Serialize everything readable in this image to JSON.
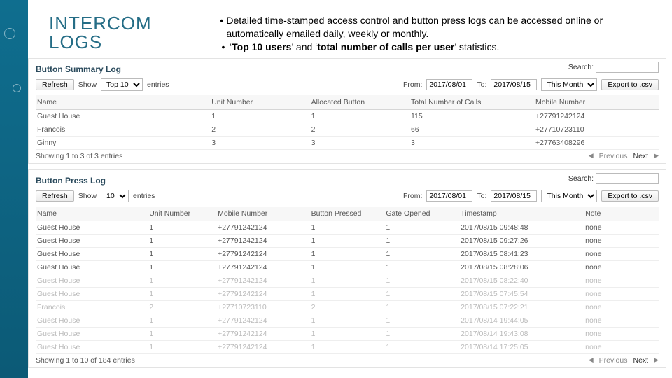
{
  "header": {
    "title_line1": "INTERCOM",
    "title_line2": "LOGS",
    "bullet1_a": "Detailed time-stamped access control and button press logs can be accessed online or automatically emailed daily, weekly or monthly.",
    "bullet2_pre": "‘",
    "bullet2_b1": "Top 10 users",
    "bullet2_mid": "’ and ‘",
    "bullet2_b2": "total number of calls per user",
    "bullet2_post": "’ statistics."
  },
  "common": {
    "refresh": "Refresh",
    "show": "Show",
    "entries": "entries",
    "from": "From:",
    "to": "To:",
    "export": "Export to .csv",
    "search": "Search:",
    "previous": "Previous",
    "next": "Next"
  },
  "summary": {
    "title": "Button Summary Log",
    "top_option": "Top 10",
    "from_val": "2017/08/01",
    "to_val": "2017/08/15",
    "range": "This Month",
    "cols": {
      "name": "Name",
      "unit": "Unit Number",
      "btn": "Allocated Button",
      "calls": "Total Number of Calls",
      "mobile": "Mobile Number"
    },
    "rows": [
      {
        "name": "Guest House",
        "unit": "1",
        "btn": "1",
        "calls": "115",
        "mobile": "+27791242124"
      },
      {
        "name": "Francois",
        "unit": "2",
        "btn": "2",
        "calls": "66",
        "mobile": "+27710723110"
      },
      {
        "name": "Ginny",
        "unit": "3",
        "btn": "3",
        "calls": "3",
        "mobile": "+27763408296"
      }
    ],
    "showing": "Showing 1 to 3 of 3 entries"
  },
  "press": {
    "title": "Button Press Log",
    "show_val": "10",
    "from_val": "2017/08/01",
    "to_val": "2017/08/15",
    "range": "This Month",
    "cols": {
      "name": "Name",
      "unit": "Unit Number",
      "mobile": "Mobile Number",
      "pressed": "Button Pressed",
      "gate": "Gate Opened",
      "ts": "Timestamp",
      "note": "Note"
    },
    "rows": [
      {
        "name": "Guest House",
        "unit": "1",
        "mobile": "+27791242124",
        "pressed": "1",
        "gate": "1",
        "ts": "2017/08/15 09:48:48",
        "note": "none",
        "dim": false
      },
      {
        "name": "Guest House",
        "unit": "1",
        "mobile": "+27791242124",
        "pressed": "1",
        "gate": "1",
        "ts": "2017/08/15 09:27:26",
        "note": "none",
        "dim": false
      },
      {
        "name": "Guest House",
        "unit": "1",
        "mobile": "+27791242124",
        "pressed": "1",
        "gate": "1",
        "ts": "2017/08/15 08:41:23",
        "note": "none",
        "dim": false
      },
      {
        "name": "Guest House",
        "unit": "1",
        "mobile": "+27791242124",
        "pressed": "1",
        "gate": "1",
        "ts": "2017/08/15 08:28:06",
        "note": "none",
        "dim": false
      },
      {
        "name": "Guest House",
        "unit": "1",
        "mobile": "+27791242124",
        "pressed": "1",
        "gate": "1",
        "ts": "2017/08/15 08:22:40",
        "note": "none",
        "dim": true
      },
      {
        "name": "Guest House",
        "unit": "1",
        "mobile": "+27791242124",
        "pressed": "1",
        "gate": "1",
        "ts": "2017/08/15 07:45:54",
        "note": "none",
        "dim": true
      },
      {
        "name": "Francois",
        "unit": "2",
        "mobile": "+27710723110",
        "pressed": "2",
        "gate": "1",
        "ts": "2017/08/15 07:22:21",
        "note": "none",
        "dim": true
      },
      {
        "name": "Guest House",
        "unit": "1",
        "mobile": "+27791242124",
        "pressed": "1",
        "gate": "1",
        "ts": "2017/08/14 19:44:05",
        "note": "none",
        "dim": true
      },
      {
        "name": "Guest House",
        "unit": "1",
        "mobile": "+27791242124",
        "pressed": "1",
        "gate": "1",
        "ts": "2017/08/14 19:43:08",
        "note": "none",
        "dim": true
      },
      {
        "name": "Guest House",
        "unit": "1",
        "mobile": "+27791242124",
        "pressed": "1",
        "gate": "1",
        "ts": "2017/08/14 17:25:05",
        "note": "none",
        "dim": true
      }
    ],
    "showing": "Showing 1 to 10 of 184 entries"
  }
}
